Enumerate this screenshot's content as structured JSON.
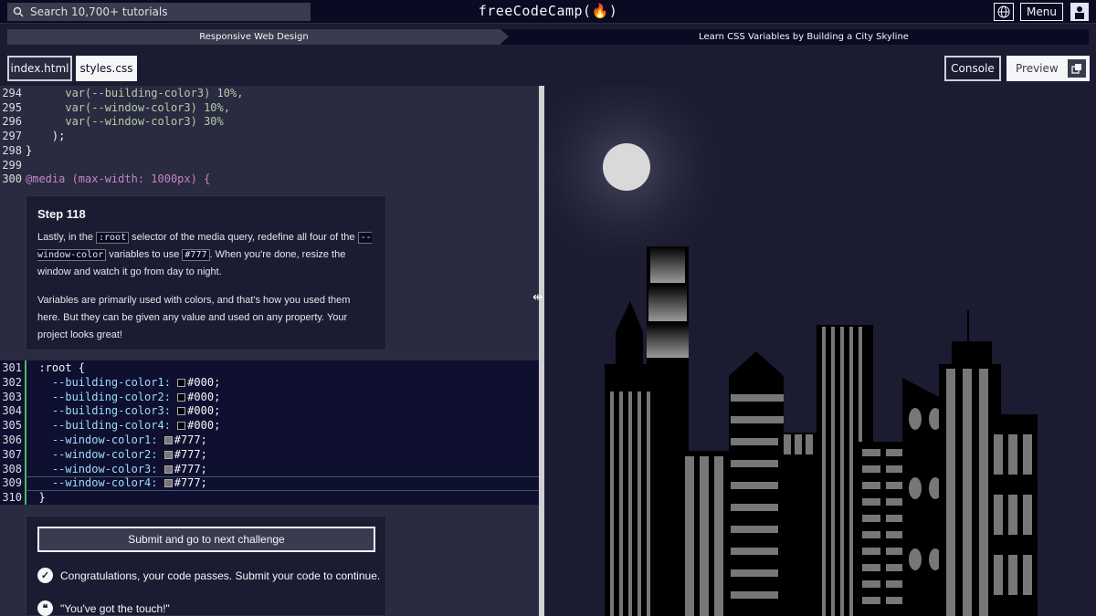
{
  "nav": {
    "search_placeholder": "Search 10,700+ tutorials",
    "logo": "freeCodeCamp(🔥)",
    "menu_label": "Menu"
  },
  "breadcrumb": {
    "course": "Responsive Web Design",
    "project": "Learn CSS Variables by Building a City Skyline"
  },
  "tabs": {
    "index": "index.html",
    "styles": "styles.css",
    "console": "Console",
    "preview": "Preview"
  },
  "code_top": [
    {
      "n": "294",
      "text": "      var(--building-color3) 10%,"
    },
    {
      "n": "295",
      "text": "      var(--window-color3) 10%,"
    },
    {
      "n": "296",
      "text": "      var(--window-color3) 30%"
    },
    {
      "n": "297",
      "text": "    );"
    },
    {
      "n": "298",
      "text": "}"
    },
    {
      "n": "299",
      "text": ""
    },
    {
      "n": "300",
      "text": "@media (max-width: 1000px) {"
    }
  ],
  "step": {
    "title": "Step 118",
    "p1_a": "Lastly, in the ",
    "p1_code1": ":root",
    "p1_b": " selector of the media query, redefine all four of the ",
    "p1_code2": "--window-color",
    "p1_c": " variables to use ",
    "p1_code3": "#777",
    "p1_d": ". When you're done, resize the window and watch it go from day to night.",
    "p2": "Variables are primarily used with colors, and that's how you used them here. But they can be given any value and used on any property. Your project looks great!"
  },
  "code_bottom": [
    {
      "n": "301",
      "text": "  :root {"
    },
    {
      "n": "302",
      "prop": "    --building-color1: ",
      "value": "#000;",
      "swatch": "#000000"
    },
    {
      "n": "303",
      "prop": "    --building-color2: ",
      "value": "#000;",
      "swatch": "#000000"
    },
    {
      "n": "304",
      "prop": "    --building-color3: ",
      "value": "#000;",
      "swatch": "#000000"
    },
    {
      "n": "305",
      "prop": "    --building-color4: ",
      "value": "#000;",
      "swatch": "#000000"
    },
    {
      "n": "306",
      "prop": "    --window-color1: ",
      "value": "#777;",
      "swatch": "#777777"
    },
    {
      "n": "307",
      "prop": "    --window-color2: ",
      "value": "#777;",
      "swatch": "#777777"
    },
    {
      "n": "308",
      "prop": "    --window-color3: ",
      "value": "#777;",
      "swatch": "#777777"
    },
    {
      "n": "309",
      "prop": "    --window-color4: ",
      "value": "#777;",
      "swatch": "#777777"
    },
    {
      "n": "310",
      "text": "  }"
    }
  ],
  "bottom": {
    "submit": "Submit and go to next challenge",
    "congrats": "Congratulations, your code passes. Submit your code to continue.",
    "quote": "\"You've got the touch!\""
  },
  "colors": {
    "nav_bg": "#0a0a23",
    "editor_bg": "#2a2a40",
    "accent_green": "#3fbf5f",
    "building": "#000000",
    "window": "#777777",
    "moon": "#d9d9d9"
  }
}
